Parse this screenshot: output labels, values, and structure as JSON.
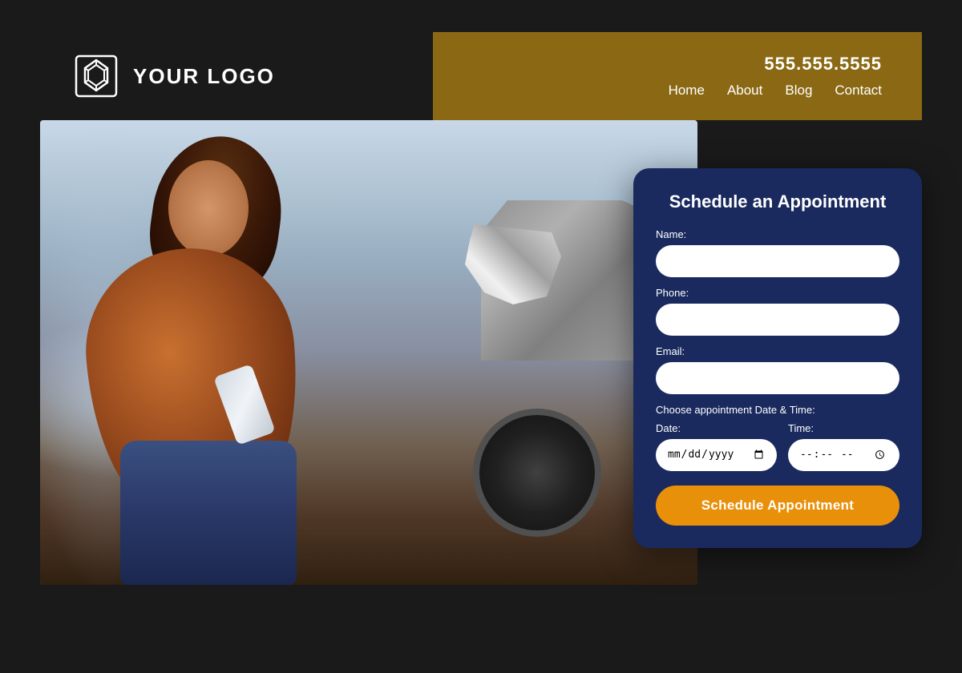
{
  "header": {
    "logo_text": "YOUR LOGO",
    "phone": "555.555.5555",
    "nav": {
      "home": "Home",
      "about": "About",
      "blog": "Blog",
      "contact": "Contact"
    }
  },
  "form": {
    "title": "Schedule an Appointment",
    "name_label": "Name:",
    "name_placeholder": "",
    "phone_label": "Phone:",
    "phone_placeholder": "",
    "email_label": "Email:",
    "email_placeholder": "",
    "datetime_section_label": "Choose appointment Date & Time:",
    "date_label": "Date:",
    "date_placeholder": "",
    "time_label": "Time:",
    "time_placeholder": "",
    "submit_label": "Schedule Appointment"
  },
  "colors": {
    "header_bg": "#1a1a1a",
    "header_right_bg": "#8B6914",
    "form_bg": "#1a2a5e",
    "button_bg": "#E8900A"
  }
}
